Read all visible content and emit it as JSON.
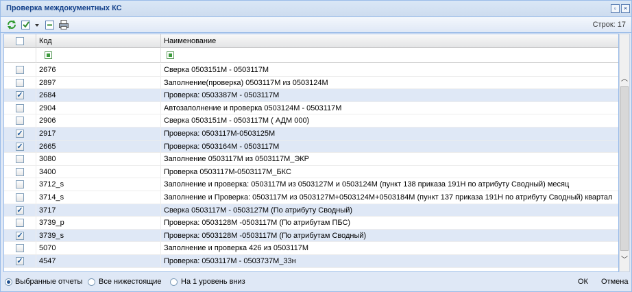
{
  "window": {
    "title": "Проверка междокументных КС"
  },
  "toolbar": {
    "rows_label": "Строк: 17"
  },
  "grid": {
    "col_code": "Код",
    "col_name": "Наименование",
    "rows": [
      {
        "code": "2676",
        "name": "Сверка 0503151М - 0503117М",
        "checked": false
      },
      {
        "code": "2897",
        "name": "Заполнение(проверка) 0503117М из 0503124М",
        "checked": false
      },
      {
        "code": "2684",
        "name": "Проверка: 0503387М - 0503117М",
        "checked": true
      },
      {
        "code": "2904",
        "name": "Автозаполнение и проверка 0503124М - 0503117М",
        "checked": false
      },
      {
        "code": "2906",
        "name": "Сверка 0503151М - 0503117М ( АДМ 000)",
        "checked": false
      },
      {
        "code": "2917",
        "name": "Проверка: 0503117М-0503125М",
        "checked": true
      },
      {
        "code": "2665",
        "name": "Проверка: 0503164М - 0503117М",
        "checked": true
      },
      {
        "code": "3080",
        "name": "Заполнение 0503117М из 0503117М_ЭКР",
        "checked": false
      },
      {
        "code": "3400",
        "name": "Проверка 0503117М-0503117М_БКС",
        "checked": false
      },
      {
        "code": "3712_s",
        "name": "Заполнение и проверка: 0503117М из 0503127М и 0503124М (пункт 138 приказа 191Н по атрибуту Сводный) месяц",
        "checked": false
      },
      {
        "code": "3714_s",
        "name": "Заполнение и Проверка: 0503117М из 0503127М+0503124М+0503184М (пункт 137 приказа 191Н по атрибуту Сводный) квартал",
        "checked": false
      },
      {
        "code": "3717",
        "name": "Сверка 0503117М - 0503127М (По атрибуту Сводный)",
        "checked": true
      },
      {
        "code": "3739_p",
        "name": "Проверка: 0503128М -0503117М (По атрибутам ПБС)",
        "checked": false
      },
      {
        "code": "3739_s",
        "name": "Проверка: 0503128М -0503117М (По атрибутам Сводный)",
        "checked": true
      },
      {
        "code": "5070",
        "name": "Заполнение и проверка 426 из 0503117М",
        "checked": false
      },
      {
        "code": "4547",
        "name": "Проверка: 0503117М - 0503737М_33н",
        "checked": true
      }
    ]
  },
  "footer": {
    "radio_selected": "Выбранные отчеты",
    "radio_all": "Все нижестоящие",
    "radio_one_level": "На 1 уровень вниз",
    "ok": "ОК",
    "cancel": "Отмена"
  },
  "colors": {
    "accent": "#15428b",
    "selected_row": "#dfe8f6",
    "border": "#99bbe8"
  }
}
